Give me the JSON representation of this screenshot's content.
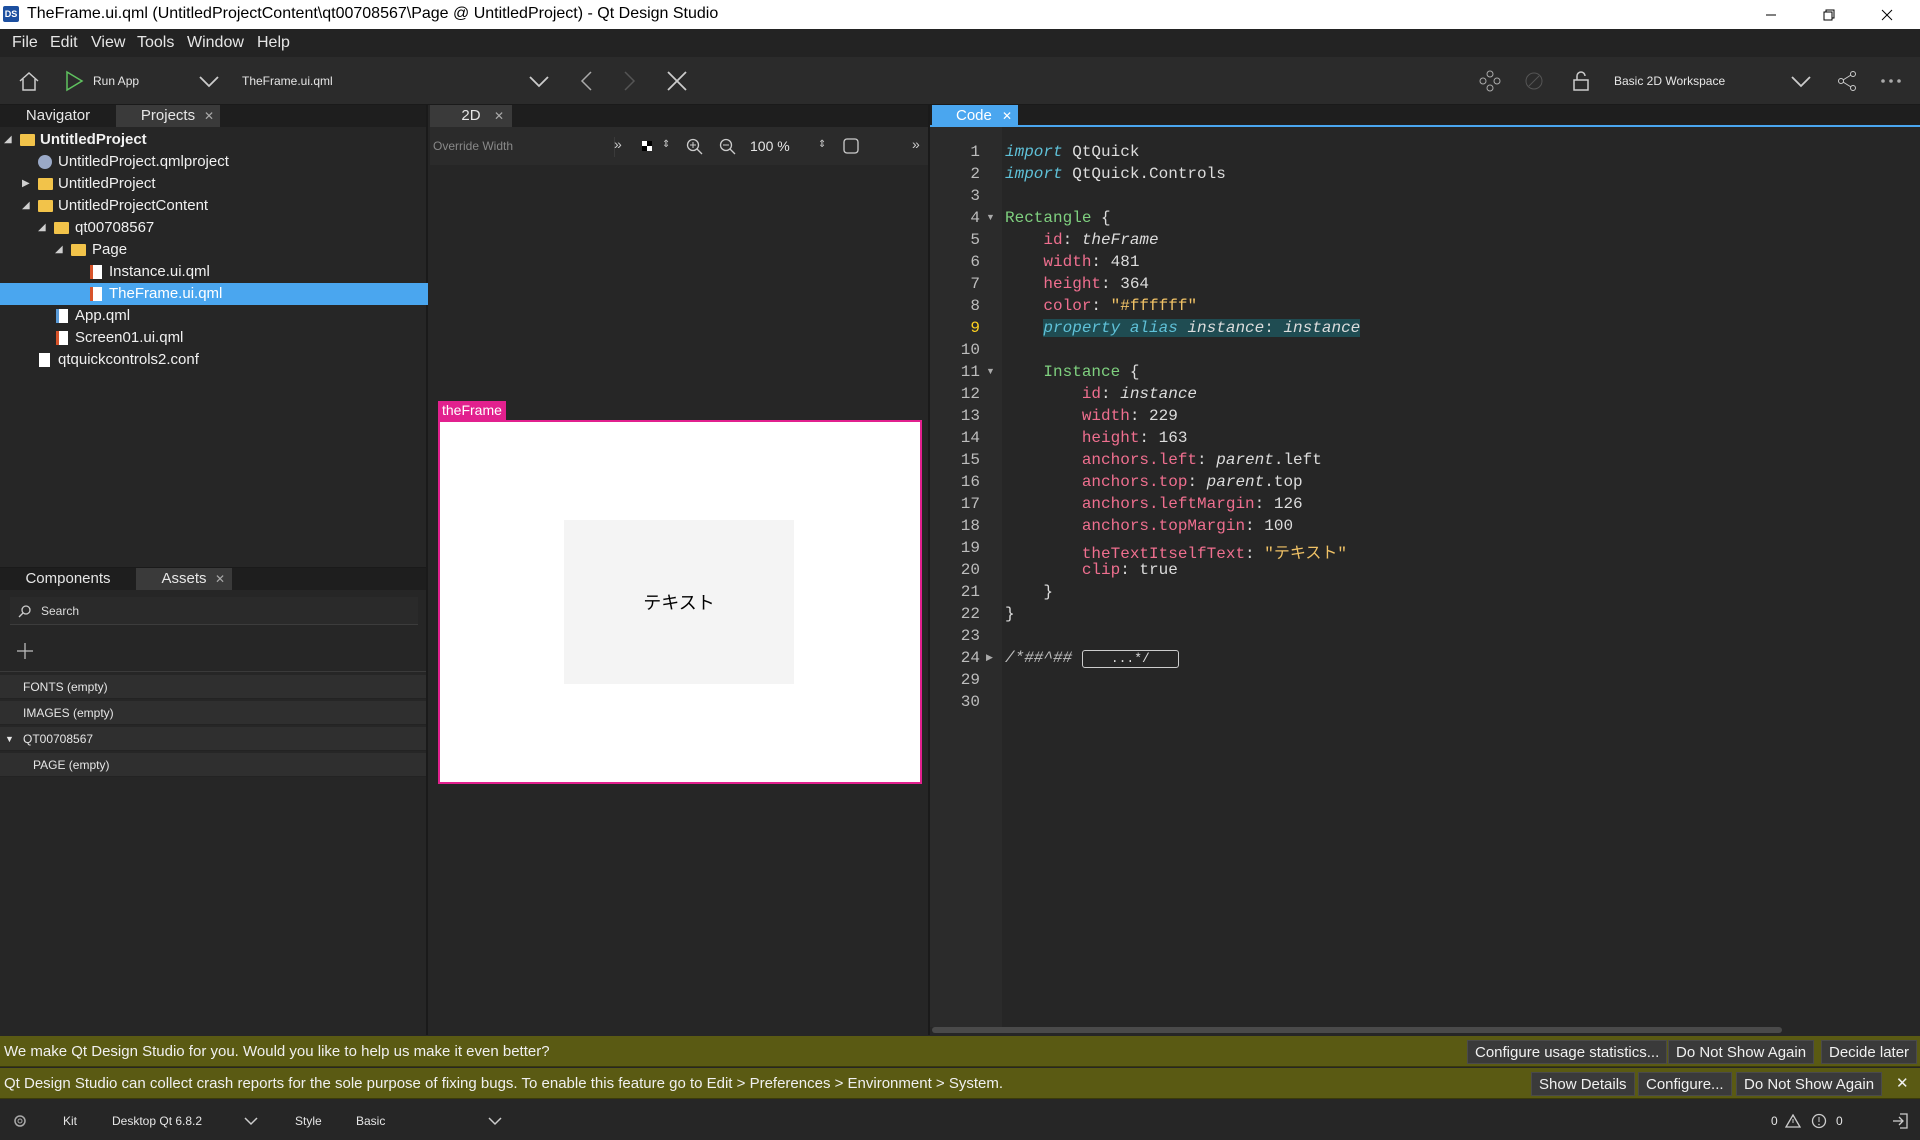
{
  "window": {
    "title": "TheFrame.ui.qml (UntitledProjectContent\\qt00708567\\Page @ UntitledProject) - Qt Design Studio",
    "app_icon_text": "DS"
  },
  "menu": [
    "File",
    "Edit",
    "View",
    "Tools",
    "Window",
    "Help"
  ],
  "toolbar": {
    "run_label": "Run App",
    "file_selector": "TheFrame.ui.qml",
    "workspace": "Basic 2D Workspace"
  },
  "left_top_tabs": {
    "navigator": "Navigator",
    "projects": "Projects"
  },
  "project_tree": [
    {
      "label": "UntitledProject",
      "icon": "project-folder-icon",
      "bold": true
    },
    {
      "label": "UntitledProject.qmlproject",
      "icon": "qmlproject-icon"
    },
    {
      "label": "UntitledProject",
      "icon": "folder-icon"
    },
    {
      "label": "UntitledProjectContent",
      "icon": "folder-icon"
    },
    {
      "label": "qt00708567",
      "icon": "folder-icon"
    },
    {
      "label": "Page",
      "icon": "folder-icon"
    },
    {
      "label": "Instance.ui.qml",
      "icon": "ui-qml-file-icon"
    },
    {
      "label": "TheFrame.ui.qml",
      "icon": "ui-qml-file-icon",
      "selected": true
    },
    {
      "label": "App.qml",
      "icon": "qml-file-icon"
    },
    {
      "label": "Screen01.ui.qml",
      "icon": "ui-qml-file-icon"
    },
    {
      "label": "qtquickcontrols2.conf",
      "icon": "file-icon"
    }
  ],
  "left_bottom_tabs": {
    "components": "Components",
    "assets": "Assets"
  },
  "assets": {
    "search_placeholder": "Search",
    "items": [
      "FONTS (empty)",
      "IMAGES (empty)",
      "QT00708567",
      "PAGE (empty)"
    ]
  },
  "editor2d": {
    "tab": "2D",
    "override_width": "Override Width",
    "zoom": "100 %",
    "frame_label": "theFrame",
    "instance_text": "テキスト"
  },
  "code_tab": "Code",
  "code_lines": [
    {
      "n": "1",
      "html": "<span class=\"kw\">import</span> QtQuick"
    },
    {
      "n": "2",
      "html": "<span class=\"kw\">import</span> QtQuick.Controls"
    },
    {
      "n": "3",
      "html": ""
    },
    {
      "n": "4",
      "html": "<span class=\"tp\">Rectangle</span> {",
      "fold": "▼"
    },
    {
      "n": "5",
      "html": "    <span class=\"pr\">id</span>: <span class=\"it\">theFrame</span>"
    },
    {
      "n": "6",
      "html": "    <span class=\"pr\">width</span>: 481"
    },
    {
      "n": "7",
      "html": "    <span class=\"pr\">height</span>: 364"
    },
    {
      "n": "8",
      "html": "    <span class=\"pr\">color</span>: <span class=\"str\">\"#ffffff\"</span>"
    },
    {
      "n": "9",
      "html": "    <span class=\"hl\"><span class=\"it\" style=\"color:#5fc1d8\">property alias</span> <span class=\"it\">instance</span>: <span class=\"it\">instance</span></span>",
      "current": true
    },
    {
      "n": "10",
      "html": ""
    },
    {
      "n": "11",
      "html": "    <span class=\"tp\">Instance</span> {",
      "fold": "▼"
    },
    {
      "n": "12",
      "html": "        <span class=\"pr\">id</span>: <span class=\"it\">instance</span>"
    },
    {
      "n": "13",
      "html": "        <span class=\"pr\">width</span>: 229"
    },
    {
      "n": "14",
      "html": "        <span class=\"pr\">height</span>: 163"
    },
    {
      "n": "15",
      "html": "        <span class=\"pr\">anchors.left</span>: <span class=\"it\">parent</span>.left"
    },
    {
      "n": "16",
      "html": "        <span class=\"pr\">anchors.top</span>: <span class=\"it\">parent</span>.top"
    },
    {
      "n": "17",
      "html": "        <span class=\"pr\">anchors.leftMargin</span>: 126"
    },
    {
      "n": "18",
      "html": "        <span class=\"pr\">anchors.topMargin</span>: 100"
    },
    {
      "n": "19",
      "html": "        <span class=\"pr\">theTextItselfText</span>: <span class=\"str\">\"テキスト\"</span>"
    },
    {
      "n": "20",
      "html": "        <span class=\"pr\">clip</span>: true"
    },
    {
      "n": "21",
      "html": "    }"
    },
    {
      "n": "22",
      "html": "}"
    },
    {
      "n": "23",
      "html": ""
    },
    {
      "n": "24",
      "html": "<span class=\"it\" style=\"color:#bdbdbd\">/*##^##</span> <span style=\"display:inline-block;border:1px solid #ccc;border-radius:3px;padding:0 28px;line-height:16px;font-size:13px\">...*/</span>",
      "fold": "▶"
    },
    {
      "n": "29",
      "html": ""
    },
    {
      "n": "30",
      "html": ""
    }
  ],
  "messages": {
    "usage": "We make Qt Design Studio for you. Would you like to help us make it even better?",
    "usage_buttons": [
      "Configure usage statistics...",
      "Do Not Show Again",
      "Decide later"
    ],
    "crash": "Qt Design Studio can collect crash reports for the sole purpose of fixing bugs. To enable this feature go to Edit > Preferences > Environment > System.",
    "crash_buttons": [
      "Show Details",
      "Configure...",
      "Do Not Show Again"
    ]
  },
  "statusbar": {
    "kit_label": "Kit",
    "kit_value": "Desktop Qt 6.8.2",
    "style_label": "Style",
    "style_value": "Basic",
    "warnings": "0",
    "errors": "0"
  },
  "colors": {
    "selection": "#4aa6ef",
    "frame": "#e2208e",
    "code_tab": "#4aa6ef",
    "message_bar": "#5a5a13"
  }
}
